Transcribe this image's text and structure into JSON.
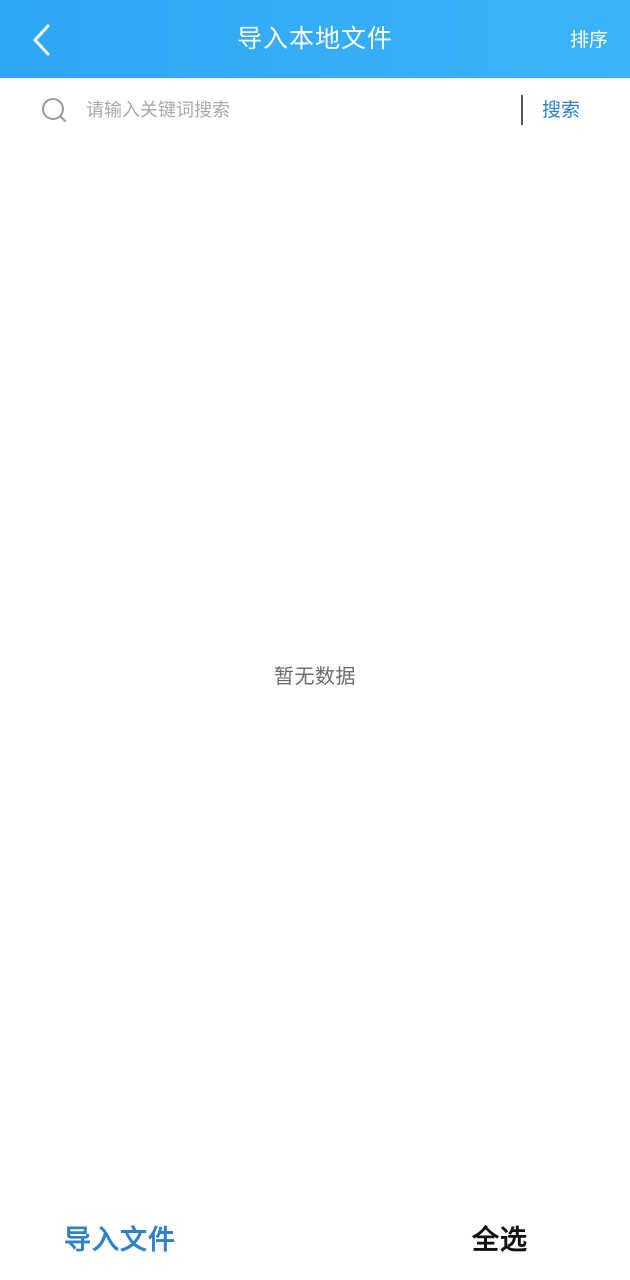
{
  "header": {
    "back_icon": "chevron-left-icon",
    "title": "导入本地文件",
    "sort_label": "排序",
    "background_color": "#2ea6f6"
  },
  "search": {
    "search_icon": "search-icon",
    "placeholder": "请输入关键词搜索",
    "value": "",
    "button_label": "搜索",
    "button_color": "#2e82c9"
  },
  "content": {
    "empty_message": "暂无数据"
  },
  "footer": {
    "import_label": "导入文件",
    "select_all_label": "全选",
    "import_color": "#2e82c9"
  }
}
